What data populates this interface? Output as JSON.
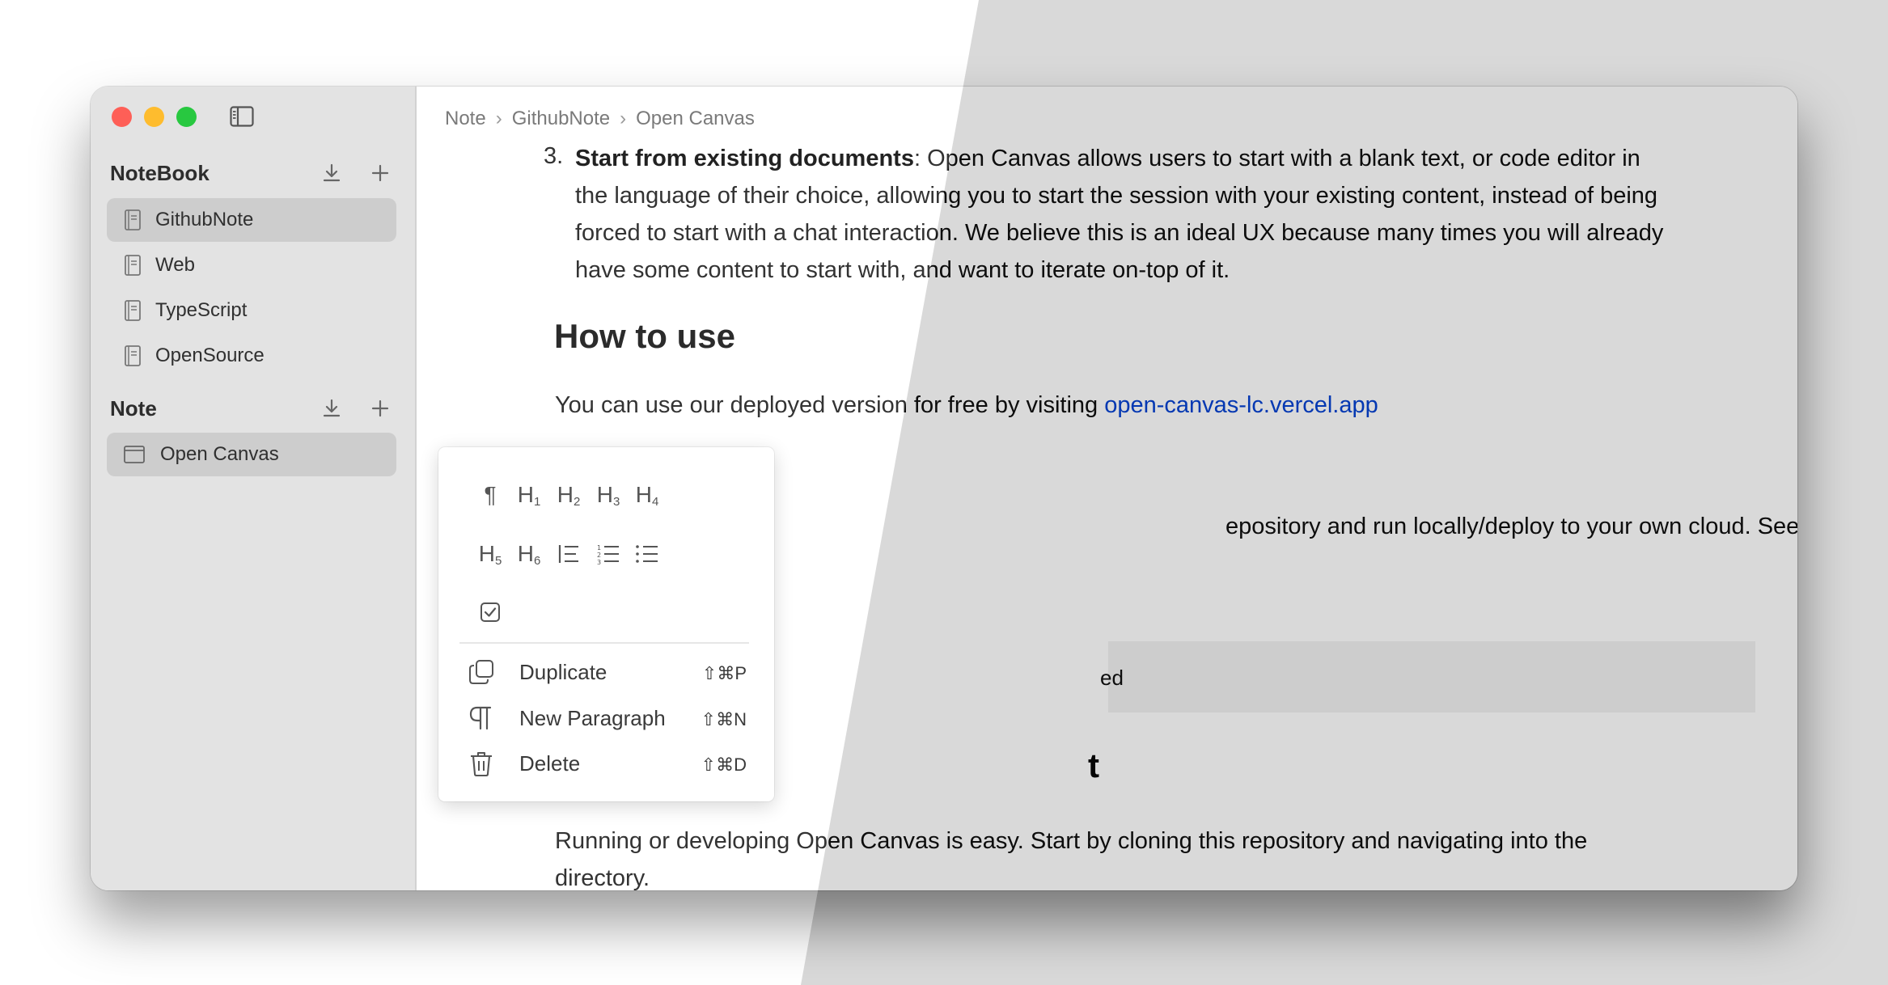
{
  "sidebar": {
    "sections": [
      {
        "title": "NoteBook",
        "items": [
          {
            "label": "GithubNote",
            "selected": true,
            "icon": "notebook-icon"
          },
          {
            "label": "Web",
            "selected": false,
            "icon": "notebook-icon"
          },
          {
            "label": "TypeScript",
            "selected": false,
            "icon": "notebook-icon"
          },
          {
            "label": "OpenSource",
            "selected": false,
            "icon": "notebook-icon"
          }
        ]
      },
      {
        "title": "Note",
        "items": [
          {
            "label": "Open Canvas",
            "selected": true,
            "icon": "window-icon"
          }
        ]
      }
    ]
  },
  "breadcrumb": [
    "Note",
    "GithubNote",
    "Open Canvas"
  ],
  "content": {
    "list_number": "3.",
    "list_item_bold": "Start from existing documents",
    "list_item_text": ": Open Canvas allows users to start with a blank text, or code editor in the language of their choice, allowing you to start the session with your existing content, instead of being forced to start with a chat interaction. We believe this is an ideal UX because many times you will already have some content to start with, and want to iterate on-top of it.",
    "heading_how_to_use": "How to use",
    "para_deployed": "You can use our deployed version for free by visiting ",
    "link_text": "open-canvas-lc.vercel.app",
    "para_partial": "epository and run locally/deploy to your own cloud. See the next section for steps",
    "code_partial": "ed",
    "heading_partial": "t",
    "para_running": "Running or developing Open Canvas is easy. Start by cloning this repository and navigating into the directory."
  },
  "block_menu": {
    "blocks": [
      {
        "icon": "paragraph-icon",
        "glyph": "¶"
      },
      {
        "icon": "heading1-icon",
        "glyph": "H",
        "sub": "1"
      },
      {
        "icon": "heading2-icon",
        "glyph": "H",
        "sub": "2"
      },
      {
        "icon": "heading3-icon",
        "glyph": "H",
        "sub": "3"
      },
      {
        "icon": "heading4-icon",
        "glyph": "H",
        "sub": "4"
      },
      {
        "icon": "heading5-icon",
        "glyph": "H",
        "sub": "5"
      },
      {
        "icon": "heading6-icon",
        "glyph": "H",
        "sub": "6"
      },
      {
        "icon": "blockquote-icon",
        "glyph": ""
      },
      {
        "icon": "ordered-list-icon",
        "glyph": ""
      },
      {
        "icon": "bullet-list-icon",
        "glyph": ""
      },
      {
        "icon": "checkbox-icon",
        "glyph": ""
      }
    ],
    "actions": [
      {
        "label": "Duplicate",
        "shortcut": "⇧⌘P",
        "icon": "duplicate-icon"
      },
      {
        "label": "New Paragraph",
        "shortcut": "⇧⌘N",
        "icon": "paragraph-icon"
      },
      {
        "label": "Delete",
        "shortcut": "⇧⌘D",
        "icon": "trash-icon"
      }
    ]
  },
  "theme": {
    "accent_link": "#2a5ed8",
    "dark_bg": "#262626",
    "sidebar_bg": "#e3e3e3"
  }
}
